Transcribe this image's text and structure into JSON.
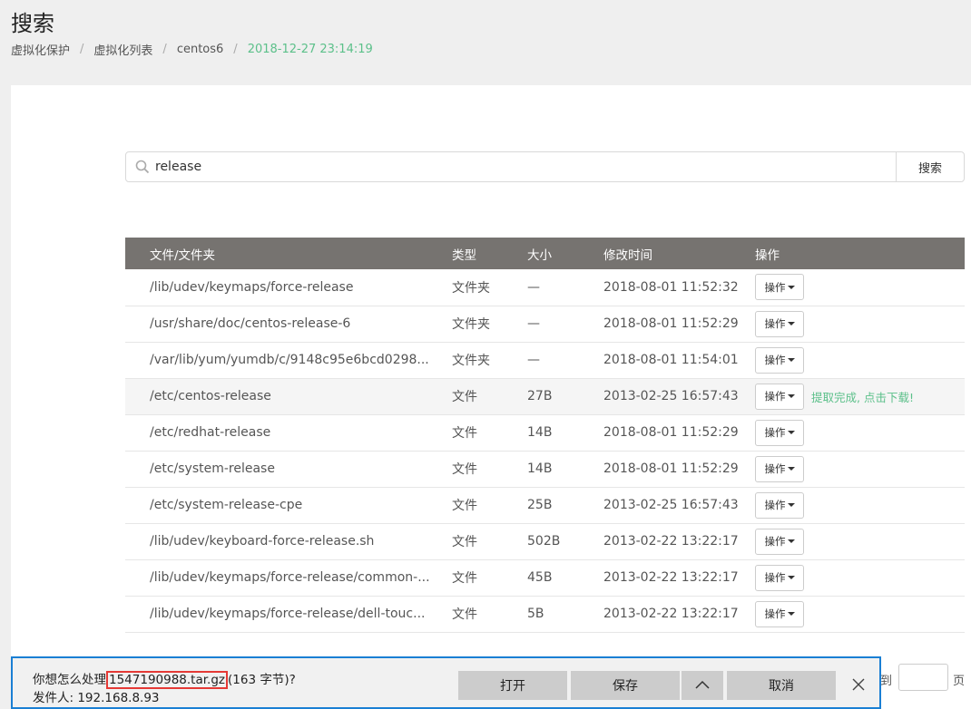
{
  "page": {
    "title": "搜索"
  },
  "breadcrumb": {
    "items": [
      "虚拟化保护",
      "虚拟化列表",
      "centos6"
    ],
    "current": "2018-12-27 23:14:19"
  },
  "search": {
    "value": "release",
    "button_label": "搜索"
  },
  "table": {
    "headers": [
      "文件/文件夹",
      "类型",
      "大小",
      "修改时间",
      "操作"
    ],
    "op_label": "操作",
    "rows": [
      {
        "name": "/lib/udev/keymaps/force-release",
        "type": "文件夹",
        "size": "—",
        "time": "2018-08-01 11:52:32"
      },
      {
        "name": "/usr/share/doc/centos-release-6",
        "type": "文件夹",
        "size": "—",
        "time": "2018-08-01 11:52:29"
      },
      {
        "name": "/var/lib/yum/yumdb/c/9148c95e6bcd0298...",
        "type": "文件夹",
        "size": "—",
        "time": "2018-08-01 11:54:01"
      },
      {
        "name": "/etc/centos-release",
        "type": "文件",
        "size": "27B",
        "time": "2013-02-25 16:57:43",
        "status": "提取完成, 点击下载!"
      },
      {
        "name": "/etc/redhat-release",
        "type": "文件",
        "size": "14B",
        "time": "2018-08-01 11:52:29"
      },
      {
        "name": "/etc/system-release",
        "type": "文件",
        "size": "14B",
        "time": "2018-08-01 11:52:29"
      },
      {
        "name": "/etc/system-release-cpe",
        "type": "文件",
        "size": "25B",
        "time": "2013-02-25 16:57:43"
      },
      {
        "name": "/lib/udev/keyboard-force-release.sh",
        "type": "文件",
        "size": "502B",
        "time": "2013-02-22 13:22:17"
      },
      {
        "name": "/lib/udev/keymaps/force-release/common-...",
        "type": "文件",
        "size": "45B",
        "time": "2013-02-22 13:22:17"
      },
      {
        "name": "/lib/udev/keymaps/force-release/dell-touc...",
        "type": "文件",
        "size": "5B",
        "time": "2013-02-22 13:22:17"
      }
    ]
  },
  "pager": {
    "to_label": "到",
    "page_label": "页",
    "page_value": ""
  },
  "download_bar": {
    "prompt_prefix": "你想怎么处理",
    "filename": "1547190988.tar.gz",
    "prompt_suffix": "(163 字节)?",
    "sender": "发件人: 192.168.8.93",
    "open_label": "打开",
    "save_label": "保存",
    "cancel_label": "取消"
  },
  "colors": {
    "header_bg": "#767370",
    "accent_green": "#5cc08a",
    "download_border": "#1a7fd4",
    "filename_highlight": "#e53935"
  }
}
